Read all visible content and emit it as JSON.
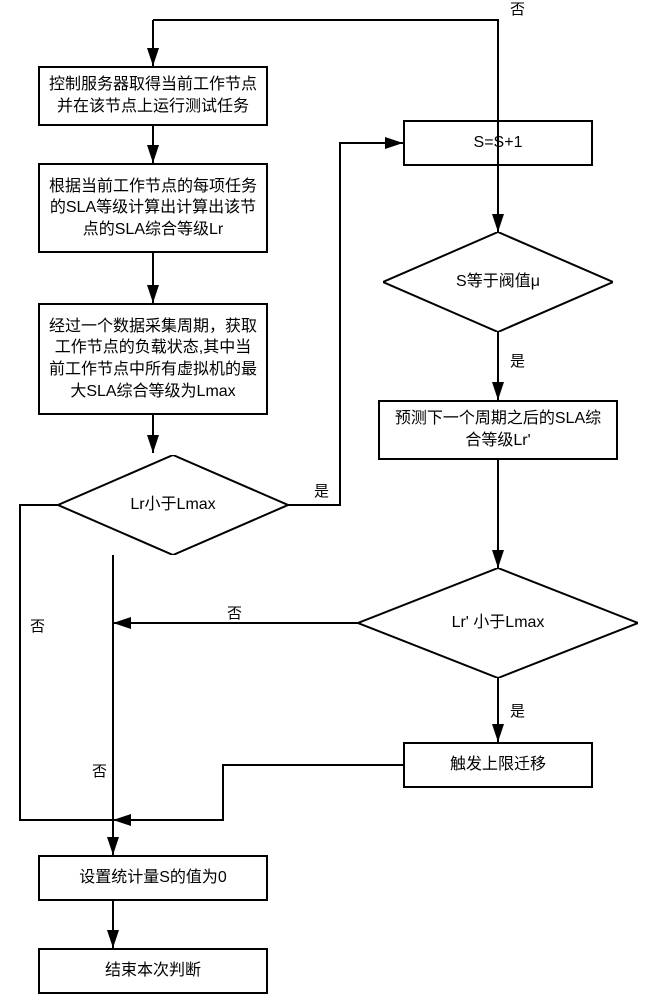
{
  "nodes": {
    "n1": "控制服务器取得当前工作节点并在该节点上运行测试任务",
    "n2": "根据当前工作节点的每项任务的SLA等级计算出计算出该节点的SLA综合等级Lr",
    "n3": "经过一个数据采集周期，获取工作节点的负载状态,其中当前工作节点中所有虚拟机的最大SLA综合等级为Lmax",
    "n4": "S=S+1",
    "n5": "预测下一个周期之后的SLA综合等级Lr'",
    "n6": "触发上限迁移",
    "n7": "设置统计量S的值为0",
    "n8": "结束本次判断"
  },
  "decisions": {
    "d1": "Lr小于Lmax",
    "d2": "S等于阀值μ",
    "d3": "Lr' 小于Lmax"
  },
  "labels": {
    "yes": "是",
    "no": "否"
  }
}
